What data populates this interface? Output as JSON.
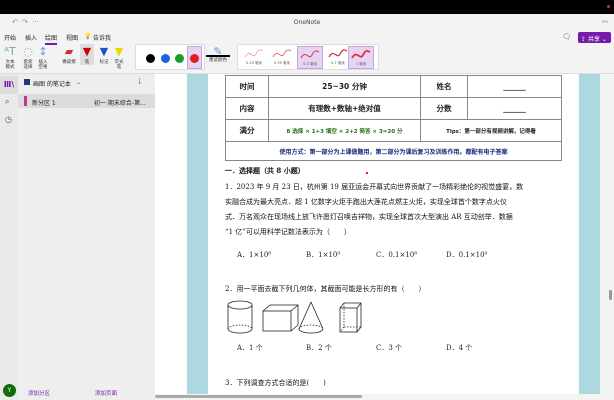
{
  "app": {
    "title": "OneNote"
  },
  "tabs": [
    {
      "label": "开始"
    },
    {
      "label": "插入"
    },
    {
      "label": "绘图"
    },
    {
      "label": "视图"
    },
    {
      "label": "告诉我"
    }
  ],
  "share_label": "共享",
  "ribbon": {
    "tools": [
      {
        "label": "文本\n模式",
        "icon": "text-mode-icon"
      },
      {
        "label": "套索\n选择",
        "icon": "lasso-icon"
      },
      {
        "label": "插入\n空格",
        "icon": "insert-space-icon"
      },
      {
        "label": "橡皮擦",
        "icon": "eraser-icon"
      },
      {
        "label": "笔",
        "icon": "pen-icon"
      },
      {
        "label": "标记",
        "icon": "marker-icon"
      },
      {
        "label": "荧光\n笔",
        "icon": "highlighter-icon"
      }
    ],
    "colors": [
      "#000000",
      "#1f5fe0",
      "#1a9c2a",
      "#e02020"
    ],
    "selected_color": "#e02020",
    "ink_color_label": "墨迹颜色",
    "thickness": [
      {
        "label": "0.25 毫米"
      },
      {
        "label": "0.35 毫米"
      },
      {
        "label": "0.5 毫米"
      },
      {
        "label": "0.7 毫米"
      },
      {
        "label": "1 毫米"
      }
    ]
  },
  "sidebar": {
    "notebook": "画图 的笔记本",
    "section": "新分区 1",
    "page": "初一 期末综合-第...",
    "add_section": "添加分区",
    "add_page": "添加页面",
    "avatar": "Y"
  },
  "doc": {
    "table": {
      "r1": [
        "时间",
        "25~30 分钟",
        "姓名",
        "______"
      ],
      "r2": [
        "内容",
        "有理数+数轴+绝对值",
        "分数",
        "______"
      ],
      "r3": [
        "满分",
        "8 选择 × 1+3 填空 × 2+2 简答 × 3=20 分",
        "Tips：第一部分有视频讲解，记得看"
      ],
      "r4": "使用方式：第一部分为上课做题用，第二部分为课后复习及训练作用。都配有电子答案"
    },
    "section": "一．选择题（共 8 小题）",
    "q1": [
      "1．2023 年 9 月 23 日，杭州第 19 届亚运会开幕式向世界贡献了一场精彩绝伦的视觉盛宴，数",
      "实融合成为最大亮点．超 1 亿数字火炬手跑出大莲花点燃主火炬，实现全球首个数字点火仪",
      "式．万名观众在现场线上放飞许愿灯召唤吉祥物，实现全球首次大型演出 AR 互动创举．数据",
      "“1 亿”可以用科学记数法表示为（　　）"
    ],
    "q1_opts": [
      "A．1×10⁸",
      "B．1×10⁹",
      "C．0.1×10⁸",
      "D．0.1×10⁹"
    ],
    "q2": "2．用一平面去截下列几何体，其截面可能是长方形的有（　　）",
    "q2_opts": [
      "A．1 个",
      "B．2 个",
      "C．3 个",
      "D．4 个"
    ],
    "q3": "3．下列调查方式合适的是(　　)"
  }
}
